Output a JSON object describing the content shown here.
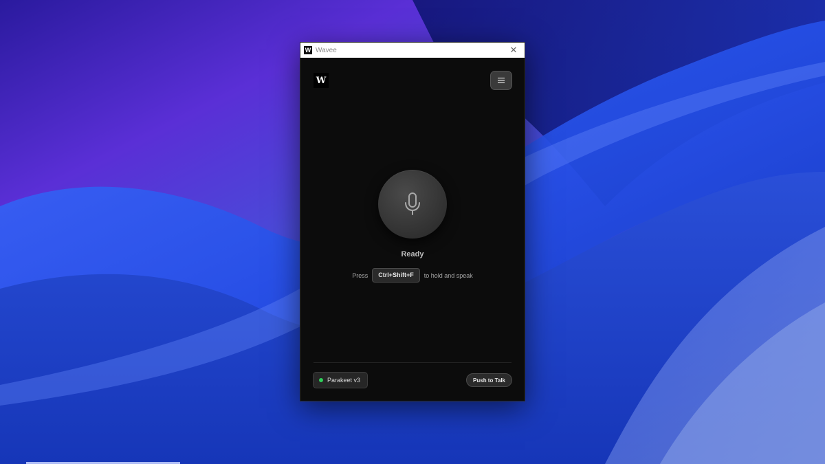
{
  "window": {
    "title": "Wavee",
    "icon_letter": "W",
    "close_glyph": "✕"
  },
  "header": {
    "logo_letter": "W",
    "menu_icon": "hamburger-icon"
  },
  "main": {
    "mic_icon": "microphone-icon",
    "status": "Ready",
    "hint_prefix": "Press",
    "hotkey": "Ctrl+Shift+F",
    "hint_suffix": "to hold and speak"
  },
  "footer": {
    "model_label": "Parakeet v3",
    "model_status_color": "#2fce5a",
    "mode_label": "Push to Talk"
  },
  "colors": {
    "window_bg": "#0c0c0c",
    "accent_green": "#2fce5a",
    "desktop_blue": "#1f2fb8",
    "desktop_purple": "#6a2fd0"
  }
}
